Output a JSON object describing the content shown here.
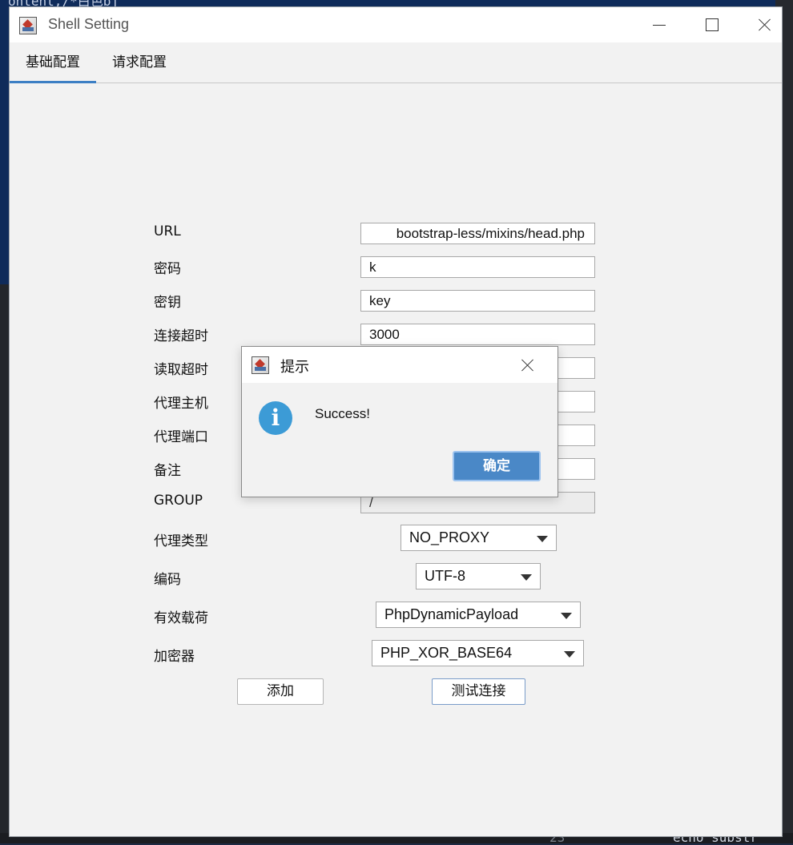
{
  "background": {
    "code_top": "ontent,/*白色bj",
    "code_echo": "echo substr",
    "code_line_num": "23"
  },
  "window": {
    "title": "Shell Setting"
  },
  "tabs": [
    {
      "label": "基础配置",
      "active": true
    },
    {
      "label": "请求配置",
      "active": false
    }
  ],
  "form": {
    "url_label": "URL",
    "url_value": "bootstrap-less/mixins/head.php",
    "password_label": "密码",
    "password_value": "k",
    "key_label": "密钥",
    "key_value": "key",
    "connect_timeout_label": "连接超时",
    "connect_timeout_value": "3000",
    "read_timeout_label": "读取超时",
    "read_timeout_value": "",
    "proxy_host_label": "代理主机",
    "proxy_host_value": "",
    "proxy_port_label": "代理端口",
    "proxy_port_value": "",
    "remark_label": "备注",
    "remark_value": "",
    "group_label": "GROUP",
    "group_value": "/",
    "proxy_type_label": "代理类型",
    "proxy_type_value": "NO_PROXY",
    "encoding_label": "编码",
    "encoding_value": "UTF-8",
    "payload_label": "有效载荷",
    "payload_value": "PhpDynamicPayload",
    "cryption_label": "加密器",
    "cryption_value": "PHP_XOR_BASE64",
    "add_button": "添加",
    "test_button": "测试连接"
  },
  "dialog": {
    "title": "提示",
    "message": "Success!",
    "ok_button": "确定"
  },
  "colors": {
    "accent": "#3d7fc4",
    "ok_button": "#4a88c7",
    "info_icon": "#3c9bd6"
  }
}
